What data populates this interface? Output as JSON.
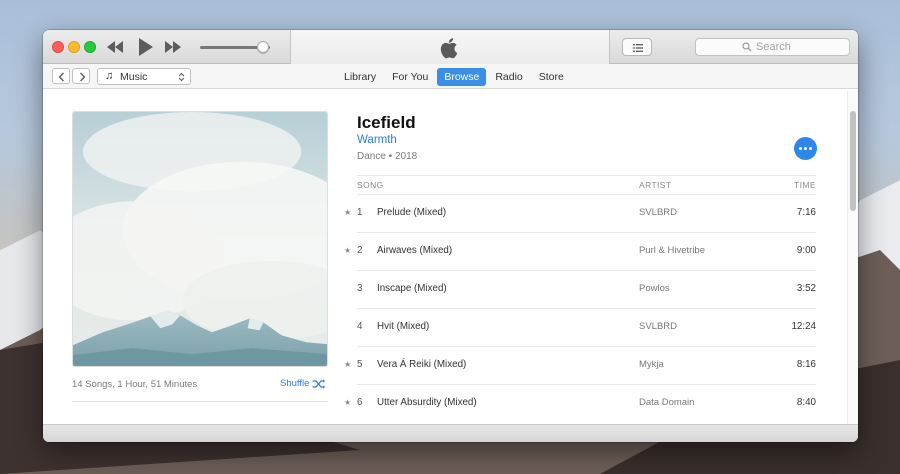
{
  "titlebar": {
    "controls": {
      "rewind_icon": "rewind-icon",
      "play_icon": "play-icon",
      "forward_icon": "fast-forward-icon"
    },
    "volume_level": 0.9,
    "search_placeholder": "Search"
  },
  "navbar": {
    "library_select": "Music",
    "tabs": [
      {
        "label": "Library"
      },
      {
        "label": "For You"
      },
      {
        "label": "Browse"
      },
      {
        "label": "Radio"
      },
      {
        "label": "Store"
      }
    ],
    "active_tab": "Browse"
  },
  "album": {
    "title": "Icefield",
    "artist": "Warmth",
    "subtitle": "Dance • 2018",
    "summary": "14 Songs, 1 Hour, 51 Minutes",
    "shuffle_label": "Shuffle"
  },
  "tracklist": {
    "headers": {
      "song": "SONG",
      "artist": "ARTIST",
      "time": "TIME"
    },
    "rows": [
      {
        "star": "★",
        "num": "1",
        "song": "Prelude (Mixed)",
        "artist": "SVLBRD",
        "time": "7:16"
      },
      {
        "star": "★",
        "num": "2",
        "song": "Airwaves (Mixed)",
        "artist": "Purl & Hivetribe",
        "time": "9:00"
      },
      {
        "star": "",
        "num": "3",
        "song": "Inscape (Mixed)",
        "artist": "Powlos",
        "time": "3:52"
      },
      {
        "star": "",
        "num": "4",
        "song": "Hvit (Mixed)",
        "artist": "SVLBRD",
        "time": "12:24"
      },
      {
        "star": "★",
        "num": "5",
        "song": "Vera Á Reiki (Mixed)",
        "artist": "Mykja",
        "time": "8:16"
      },
      {
        "star": "★",
        "num": "6",
        "song": "Utter Absurdity (Mixed)",
        "artist": "Data Domain",
        "time": "8:40"
      }
    ]
  },
  "colors": {
    "accent": "#2f86e9",
    "link": "#2c7be0"
  }
}
